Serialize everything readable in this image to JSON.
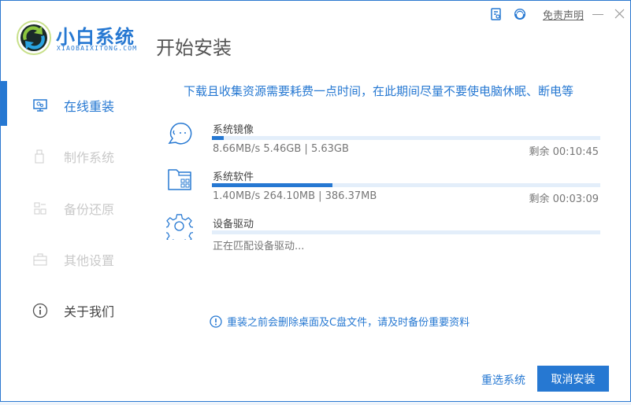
{
  "brand": {
    "name": "小白系统",
    "subtitle": "XIAOBAIXITONG.COM"
  },
  "page_title": "开始安装",
  "topbar": {
    "disclaimer": "免责声明"
  },
  "sidebar": {
    "items": [
      {
        "label": "在线重装",
        "icon": "monitor-icon",
        "active": true
      },
      {
        "label": "制作系统",
        "icon": "usb-icon"
      },
      {
        "label": "备份还原",
        "icon": "backup-icon"
      },
      {
        "label": "其他设置",
        "icon": "briefcase-icon"
      },
      {
        "label": "关于我们",
        "icon": "info-icon"
      }
    ]
  },
  "notice": "下载且收集资源需要耗费一点时间，在此期间尽量不要使电脑休眠、断电等",
  "tasks": [
    {
      "name": "系统镜像",
      "info": "8.66MB/s 5.46GB | 5.63GB",
      "remain": "剩余 00:10:45",
      "progress": 3
    },
    {
      "name": "系统软件",
      "info": "1.40MB/s 264.10MB | 386.37MB",
      "remain": "剩余 00:03:09",
      "progress": 31
    },
    {
      "name": "设备驱动",
      "info": "正在匹配设备驱动...",
      "progress": 0
    }
  ],
  "warning": "重装之前会删除桌面及C盘文件，请及时备份重要资料",
  "buttons": {
    "reselect": "重选系统",
    "cancel": "取消安装"
  },
  "colors": {
    "accent": "#2678d2",
    "track": "#e3eefa"
  }
}
